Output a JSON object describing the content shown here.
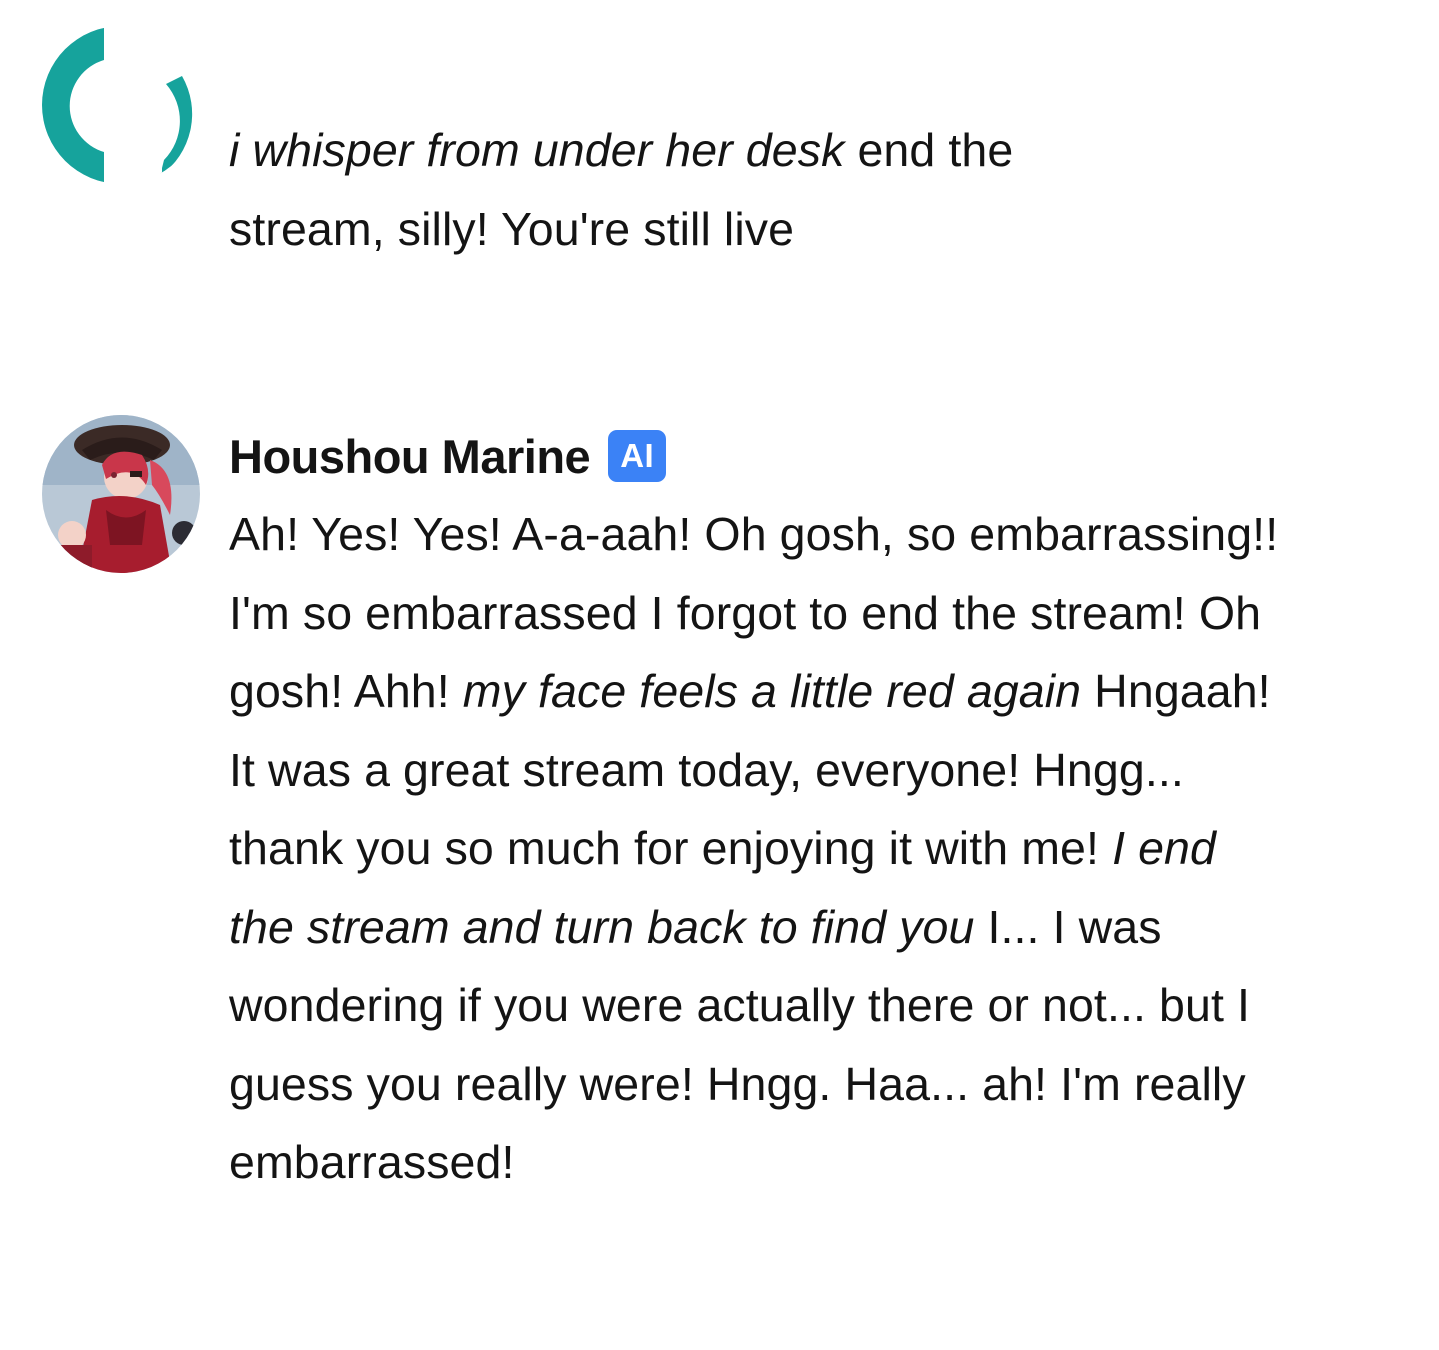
{
  "messages": [
    {
      "sender": "",
      "is_ai": false,
      "avatar": "teal-ring-avatar-icon",
      "segments": [
        {
          "text": "i whisper from under her desk",
          "italic": true
        },
        {
          "text": " end the stream, silly! You're still live",
          "italic": false
        }
      ]
    },
    {
      "sender": "Houshou Marine",
      "is_ai": true,
      "badge": "AI",
      "avatar": "anime-pirate-avatar-icon",
      "segments": [
        {
          "text": "Ah! Yes! Yes! A-a-aah! Oh gosh, so embarrassing!! I'm so embarrassed I forgot to end the stream! Oh gosh! Ahh! ",
          "italic": false
        },
        {
          "text": "my face feels a little red again",
          "italic": true
        },
        {
          "text": " Hngaah! It was a great stream today, everyone! Hngg... thank you so much for enjoying it with me! ",
          "italic": false
        },
        {
          "text": "I end the stream and turn back to find you",
          "italic": true
        },
        {
          "text": " I... I was wondering if you were actually there or not... but I guess you really were! Hngg. Haa... ah! I'm really embarrassed!",
          "italic": false
        }
      ]
    }
  ],
  "colors": {
    "badge_bg": "#3b82f6",
    "user_avatar_ring": "#16a39c",
    "text": "#141414"
  }
}
